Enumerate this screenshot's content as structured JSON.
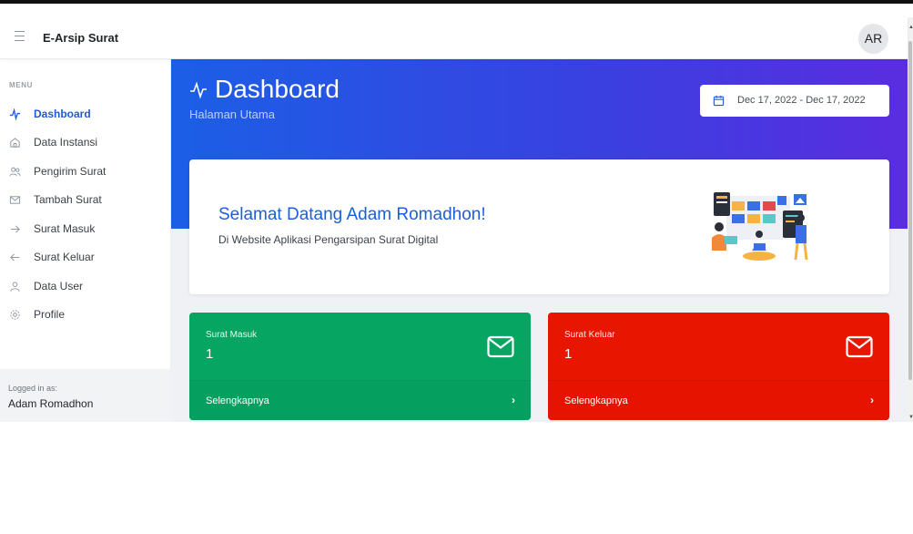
{
  "app": {
    "title": "E-Arsip Surat",
    "avatar_initials": "AR"
  },
  "sidebar": {
    "heading": "MENU",
    "items": [
      {
        "label": "Dashboard",
        "icon": "pulse-icon",
        "active": true
      },
      {
        "label": "Data Instansi",
        "icon": "home-icon"
      },
      {
        "label": "Pengirim Surat",
        "icon": "users-icon"
      },
      {
        "label": "Tambah Surat",
        "icon": "mail-icon"
      },
      {
        "label": "Surat Masuk",
        "icon": "arrow-right-icon"
      },
      {
        "label": "Surat Keluar",
        "icon": "arrow-left-icon"
      },
      {
        "label": "Data User",
        "icon": "user-icon"
      },
      {
        "label": "Profile",
        "icon": "gear-icon"
      }
    ],
    "logged_caption": "Logged in as:",
    "logged_name": "Adam Romadhon"
  },
  "header": {
    "title": "Dashboard",
    "subtitle": "Halaman Utama",
    "date_range": "Dec 17, 2022 - Dec 17, 2022"
  },
  "welcome": {
    "title": "Selamat Datang Adam Romadhon!",
    "subtitle": "Di Website Aplikasi Pengarsipan Surat Digital"
  },
  "stats": [
    {
      "title": "Surat Masuk",
      "value": "1",
      "link": "Selengkapnya",
      "color": "#06a562"
    },
    {
      "title": "Surat Keluar",
      "value": "1",
      "link": "Selengkapnya",
      "color": "#e81500"
    }
  ],
  "colors": {
    "accent": "#1e5bd6",
    "hero_start": "#1b5fe6",
    "hero_end": "#5a2de0"
  }
}
